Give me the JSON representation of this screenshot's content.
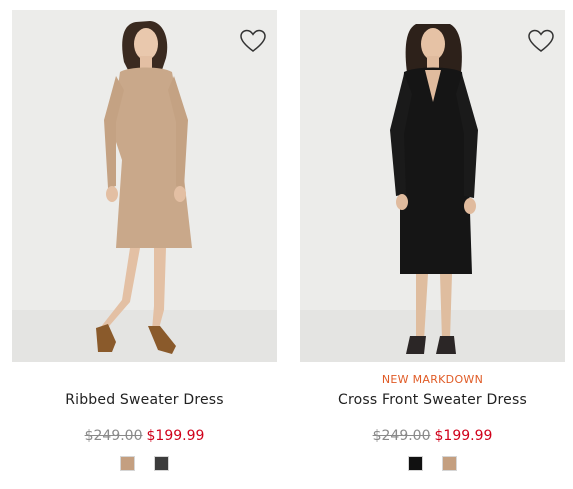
{
  "products": [
    {
      "name": "Ribbed Sweater Dress",
      "badge": "",
      "original_price": "$249.00",
      "sale_price": "$199.99",
      "swatch_colors": [
        "#c49f80",
        "#3c3c3c"
      ],
      "icon": "heart-icon"
    },
    {
      "name": "Cross Front Sweater Dress",
      "badge": "NEW MARKDOWN",
      "original_price": "$249.00",
      "sale_price": "$199.99",
      "swatch_colors": [
        "#111111",
        "#c49f80"
      ],
      "icon": "heart-icon"
    }
  ],
  "colors": {
    "badge": "#e05b26",
    "sale_price": "#d0021b",
    "original_price": "#8a8a8a",
    "photo_background": "#ececea"
  }
}
